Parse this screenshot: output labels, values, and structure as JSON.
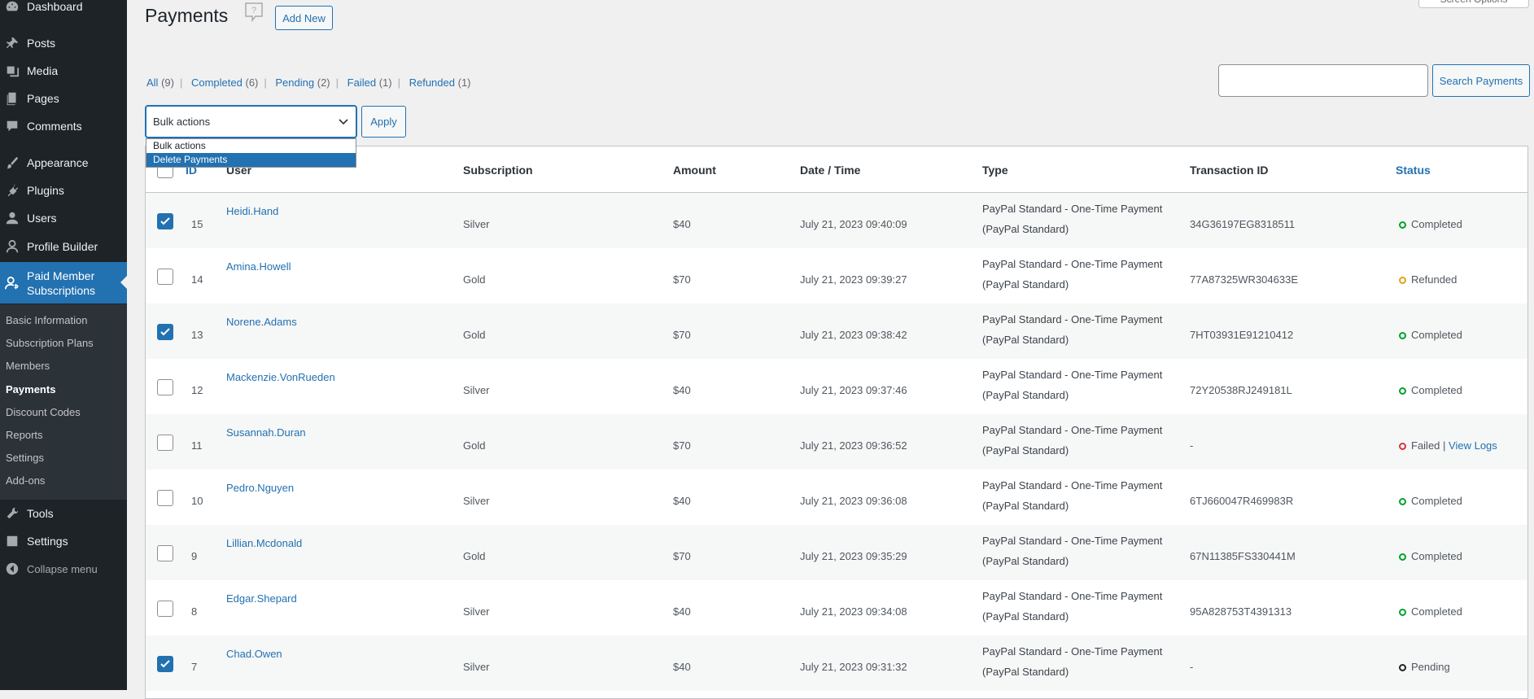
{
  "sidebar": {
    "items": [
      {
        "label": "Dashboard",
        "icon": "dashboard-icon"
      },
      {
        "label": "Posts",
        "icon": "pin-icon"
      },
      {
        "label": "Media",
        "icon": "media-icon"
      },
      {
        "label": "Pages",
        "icon": "pages-icon"
      },
      {
        "label": "Comments",
        "icon": "comment-icon"
      },
      {
        "label": "Appearance",
        "icon": "brush-icon"
      },
      {
        "label": "Plugins",
        "icon": "plugin-icon"
      },
      {
        "label": "Users",
        "icon": "user-icon"
      },
      {
        "label": "Profile Builder",
        "icon": "profile-icon"
      },
      {
        "label": "Paid Member Subscriptions",
        "icon": "members-icon"
      },
      {
        "label": "Tools",
        "icon": "wrench-icon"
      },
      {
        "label": "Settings",
        "icon": "settings-icon"
      }
    ],
    "submenu": [
      "Basic Information",
      "Subscription Plans",
      "Members",
      "Payments",
      "Discount Codes",
      "Reports",
      "Settings",
      "Add-ons"
    ],
    "collapse_label": "Collapse menu"
  },
  "header": {
    "title": "Payments",
    "add_new_label": "Add New",
    "screen_options_label": "Screen Options"
  },
  "filters": [
    {
      "label": "All",
      "count": "(9)"
    },
    {
      "label": "Completed",
      "count": "(6)"
    },
    {
      "label": "Pending",
      "count": "(2)"
    },
    {
      "label": "Failed",
      "count": "(1)"
    },
    {
      "label": "Refunded",
      "count": "(1)"
    }
  ],
  "search": {
    "button_label": "Search Payments",
    "value": ""
  },
  "bulk": {
    "selected": "Bulk actions",
    "options": [
      "Bulk actions",
      "Delete Payments"
    ],
    "highlighted": "Delete Payments",
    "apply_label": "Apply"
  },
  "table": {
    "columns": [
      "ID",
      "User",
      "Subscription",
      "Amount",
      "Date / Time",
      "Type",
      "Transaction ID",
      "Status"
    ],
    "rows": [
      {
        "checked": true,
        "id": "15",
        "user": "Heidi.Hand",
        "subscription": "Silver",
        "amount": "$40",
        "date": "July 21, 2023 09:40:09",
        "type1": "PayPal Standard - One-Time Payment",
        "type2": "(PayPal Standard)",
        "txn": "34G36197EG8318511",
        "status": "Completed",
        "status_color": "#00a32a"
      },
      {
        "checked": false,
        "id": "14",
        "user": "Amina.Howell",
        "subscription": "Gold",
        "amount": "$70",
        "date": "July 21, 2023 09:39:27",
        "type1": "PayPal Standard - One-Time Payment",
        "type2": "(PayPal Standard)",
        "txn": "77A87325WR304633E",
        "status": "Refunded",
        "status_color": "#dba617"
      },
      {
        "checked": true,
        "id": "13",
        "user": "Norene.Adams",
        "subscription": "Gold",
        "amount": "$70",
        "date": "July 21, 2023 09:38:42",
        "type1": "PayPal Standard - One-Time Payment",
        "type2": "(PayPal Standard)",
        "txn": "7HT03931E91210412",
        "status": "Completed",
        "status_color": "#00a32a"
      },
      {
        "checked": false,
        "id": "12",
        "user": "Mackenzie.VonRueden",
        "subscription": "Silver",
        "amount": "$40",
        "date": "July 21, 2023 09:37:46",
        "type1": "PayPal Standard - One-Time Payment",
        "type2": "(PayPal Standard)",
        "txn": "72Y20538RJ249181L",
        "status": "Completed",
        "status_color": "#00a32a"
      },
      {
        "checked": false,
        "id": "11",
        "user": "Susannah.Duran",
        "subscription": "Gold",
        "amount": "$70",
        "date": "July 21, 2023 09:36:52",
        "type1": "PayPal Standard - One-Time Payment",
        "type2": "(PayPal Standard)",
        "txn": "-",
        "status": "Failed",
        "status_color": "#d63638",
        "status_link": "View Logs"
      },
      {
        "checked": false,
        "id": "10",
        "user": "Pedro.Nguyen",
        "subscription": "Silver",
        "amount": "$40",
        "date": "July 21, 2023 09:36:08",
        "type1": "PayPal Standard - One-Time Payment",
        "type2": "(PayPal Standard)",
        "txn": "6TJ660047R469983R",
        "status": "Completed",
        "status_color": "#00a32a"
      },
      {
        "checked": false,
        "id": "9",
        "user": "Lillian.Mcdonald",
        "subscription": "Gold",
        "amount": "$70",
        "date": "July 21, 2023 09:35:29",
        "type1": "PayPal Standard - One-Time Payment",
        "type2": "(PayPal Standard)",
        "txn": "67N11385FS330441M",
        "status": "Completed",
        "status_color": "#00a32a"
      },
      {
        "checked": false,
        "id": "8",
        "user": "Edgar.Shepard",
        "subscription": "Silver",
        "amount": "$40",
        "date": "July 21, 2023 09:34:08",
        "type1": "PayPal Standard - One-Time Payment",
        "type2": "(PayPal Standard)",
        "txn": "95A828753T4391313",
        "status": "Completed",
        "status_color": "#00a32a"
      },
      {
        "checked": true,
        "id": "7",
        "user": "Chad.Owen",
        "subscription": "Silver",
        "amount": "$40",
        "date": "July 21, 2023 09:31:32",
        "type1": "PayPal Standard - One-Time Payment",
        "type2": "(PayPal Standard)",
        "txn": "-",
        "status": "Pending",
        "status_color": "#1d2327"
      }
    ]
  },
  "colors": {
    "accent": "#2271b1",
    "sidebar_bg": "#1d2327",
    "submenu_bg": "#2c3338",
    "page_bg": "#f0f0f1"
  }
}
